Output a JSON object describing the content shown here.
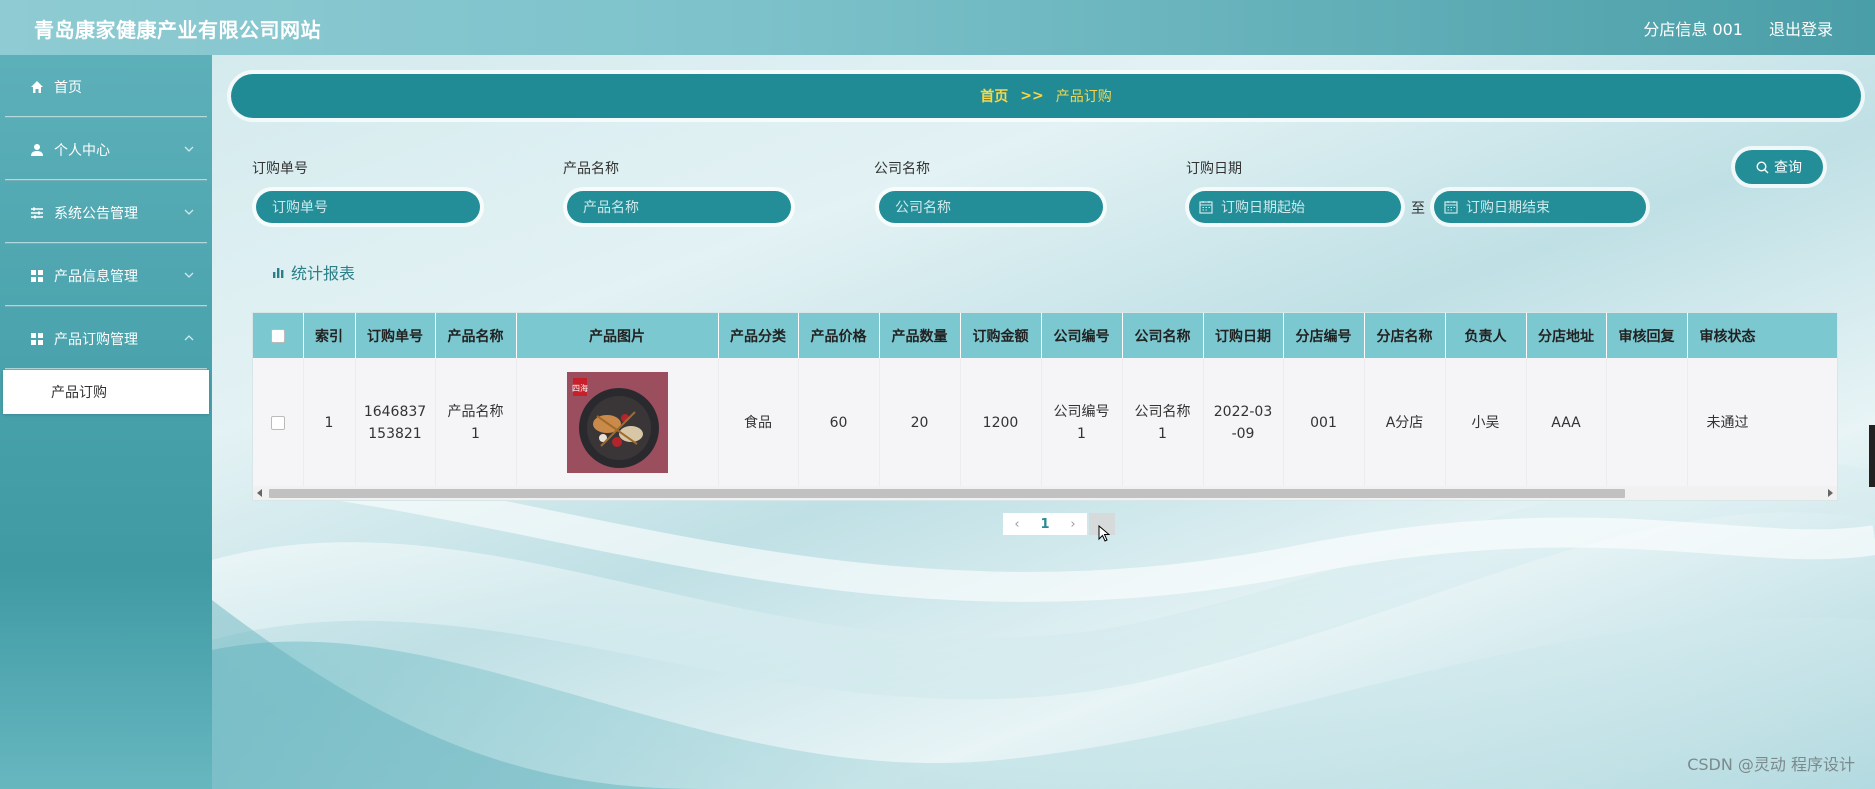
{
  "header": {
    "title": "青岛康家健康产业有限公司网站",
    "user": "分店信息 001",
    "logout": "退出登录"
  },
  "sidebar": {
    "items": [
      {
        "label": "首页",
        "icon": "home-icon"
      },
      {
        "label": "个人中心",
        "icon": "user-icon"
      },
      {
        "label": "系统公告管理",
        "icon": "sliders-icon"
      },
      {
        "label": "产品信息管理",
        "icon": "grid-icon"
      },
      {
        "label": "产品订购管理",
        "icon": "grid-icon"
      }
    ],
    "sub_active": "产品订购"
  },
  "breadcrumb": {
    "home": "首页",
    "separator": ">>",
    "current": "产品订购"
  },
  "search": {
    "order_no_label": "订购单号",
    "order_no_placeholder": "订购单号",
    "product_name_label": "产品名称",
    "product_name_placeholder": "产品名称",
    "company_label": "公司名称",
    "company_placeholder": "公司名称",
    "date_label": "订购日期",
    "date_start_placeholder": "订购日期起始",
    "date_to": "至",
    "date_end_placeholder": "订购日期结束",
    "query_button": "查询"
  },
  "report_link": "统计报表",
  "table": {
    "columns": [
      "索引",
      "订购单号",
      "产品名称",
      "产品图片",
      "产品分类",
      "产品价格",
      "产品数量",
      "订购金额",
      "公司编号",
      "公司名称",
      "订购日期",
      "分店编号",
      "分店名称",
      "负责人",
      "分店地址",
      "审核回复",
      "审核状态"
    ],
    "rows": [
      {
        "index": "1",
        "order_no_line1": "1646837",
        "order_no_line2": "153821",
        "product_name_line1": "产品名称",
        "product_name_line2": "1",
        "image_badge": "四海",
        "category": "食品",
        "price": "60",
        "quantity": "20",
        "amount": "1200",
        "company_no_line1": "公司编号",
        "company_no_line2": "1",
        "company_name_line1": "公司名称",
        "company_name_line2": "1",
        "date_line1": "2022-03",
        "date_line2": "-09",
        "branch_no": "001",
        "branch_name": "A分店",
        "manager": "小吴",
        "branch_address": "AAA",
        "review_reply": "",
        "review_status": "未通过"
      }
    ]
  },
  "pagination": {
    "prev": "‹",
    "current": "1",
    "next": "›"
  },
  "watermark": "CSDN @灵动 程序设计",
  "colors": {
    "primary": "#248e98",
    "breadcrumb_text": "#f7d64a",
    "table_header": "#7cc8d0"
  }
}
